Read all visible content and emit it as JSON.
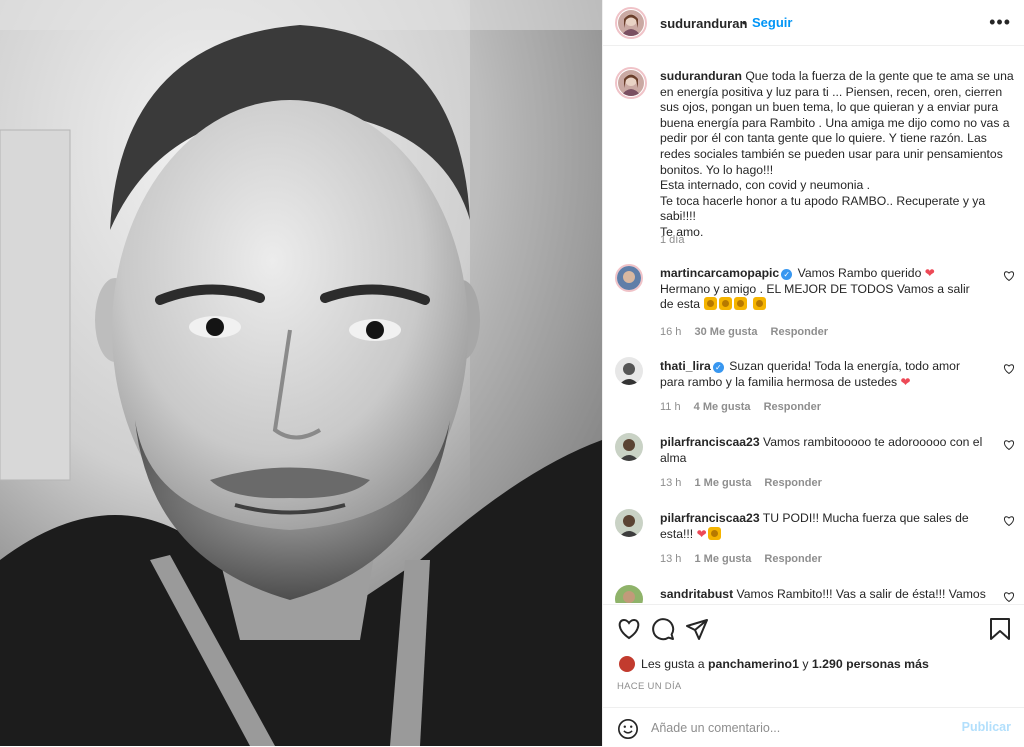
{
  "post": {
    "author": "suduranduran",
    "follow_label": "Seguir",
    "separator": "•",
    "more_label": "•••",
    "caption": "Que toda la fuerza de la gente que te ama se una en energía positiva y luz para ti ... Piensen, recen, oren, cierren sus ojos, pongan un buen tema, lo que quieran y a enviar pura buena energía para Rambito . Una amiga me dijo como no vas a pedir por él con tanta gente que lo quiere. Y tiene razón. Las redes sociales también se pueden usar para unir pensamientos bonitos. Yo lo hago!!!\nEsta internado, con covid y neumonia .\nTe toca hacerle honor a tu apodo RAMBO.. Recuperate y ya sabi!!!!\nTe amo.",
    "caption_time": "1 día"
  },
  "comments": [
    {
      "user": "martincarcamopapic",
      "verified": true,
      "text_a": "Vamos Rambo querido",
      "text_b": "Hermano y amigo . EL MEJOR DE TODOS Vamos a salir de esta",
      "time": "16 h",
      "likes": "30 Me gusta",
      "reply": "Responder"
    },
    {
      "user": "thati_lira",
      "verified": true,
      "text_a": "Suzan querida! Toda la energía, todo amor para rambo y la familia hermosa de ustedes",
      "time": "11 h",
      "likes": "4 Me gusta",
      "reply": "Responder"
    },
    {
      "user": "pilarfranciscaa23",
      "verified": false,
      "text_a": "Vamos rambitooooo te adorooooo con el alma",
      "time": "13 h",
      "likes": "1 Me gusta",
      "reply": "Responder"
    },
    {
      "user": "pilarfranciscaa23",
      "verified": false,
      "text_a": "TU PODI!! Mucha fuerza que sales de esta!!!",
      "time": "13 h",
      "likes": "1 Me gusta",
      "reply": "Responder"
    },
    {
      "user": "sandritabust",
      "verified": false,
      "text_a": "Vamos Rambito!!! Vas a salir de ésta!!! Vamos q se"
    }
  ],
  "footer": {
    "likes_prefix": "Les gusta a ",
    "likes_user": "panchamerino1",
    "likes_mid": " y ",
    "likes_count": "1.290 personas más",
    "time_ago": "HACE UN DÍA",
    "comment_placeholder": "Añade un comentario...",
    "publish_label": "Publicar"
  },
  "colors": {
    "accent": "#0095f6",
    "heart": "#ed4956",
    "publish_disabled": "#b2dffc"
  }
}
